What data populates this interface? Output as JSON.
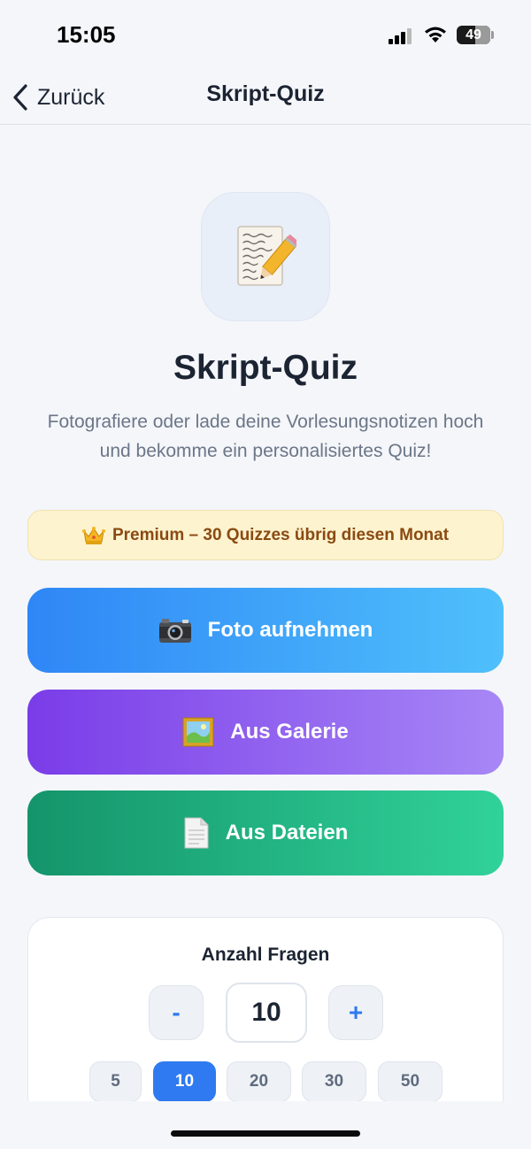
{
  "status_bar": {
    "time": "15:05",
    "battery_level": "49",
    "icons": [
      "cellular-signal-icon",
      "wifi-icon",
      "battery-icon"
    ]
  },
  "nav": {
    "back_label": "Zurück",
    "title": "Skript-Quiz"
  },
  "hero": {
    "icon": "memo-pencil-icon",
    "title": "Skript-Quiz",
    "subtitle": "Fotografiere oder lade deine Vorlesungsnotizen hoch und bekomme ein personalisiertes Quiz!"
  },
  "premium": {
    "icon": "crown-icon",
    "text": "Premium – 30 Quizzes übrig diesen Monat"
  },
  "actions": [
    {
      "label": "Foto aufnehmen",
      "icon": "camera-icon",
      "colors": [
        "#2f86f6",
        "#4fc0fb"
      ]
    },
    {
      "label": "Aus Galerie",
      "icon": "framed-picture-icon",
      "colors": [
        "#7a3ce8",
        "#a787f6"
      ]
    },
    {
      "label": "Aus Dateien",
      "icon": "document-icon",
      "colors": [
        "#14946a",
        "#31d29a"
      ]
    }
  ],
  "question_count": {
    "title": "Anzahl Fragen",
    "minus_label": "-",
    "plus_label": "+",
    "value": "10",
    "presets": [
      "5",
      "10",
      "20",
      "30",
      "50"
    ],
    "selected_preset": "10"
  },
  "colors": {
    "accent": "#2f7af0",
    "background": "#f4f6fa",
    "premium_bg": "#fdf3cf",
    "premium_text": "#8a4a12"
  }
}
